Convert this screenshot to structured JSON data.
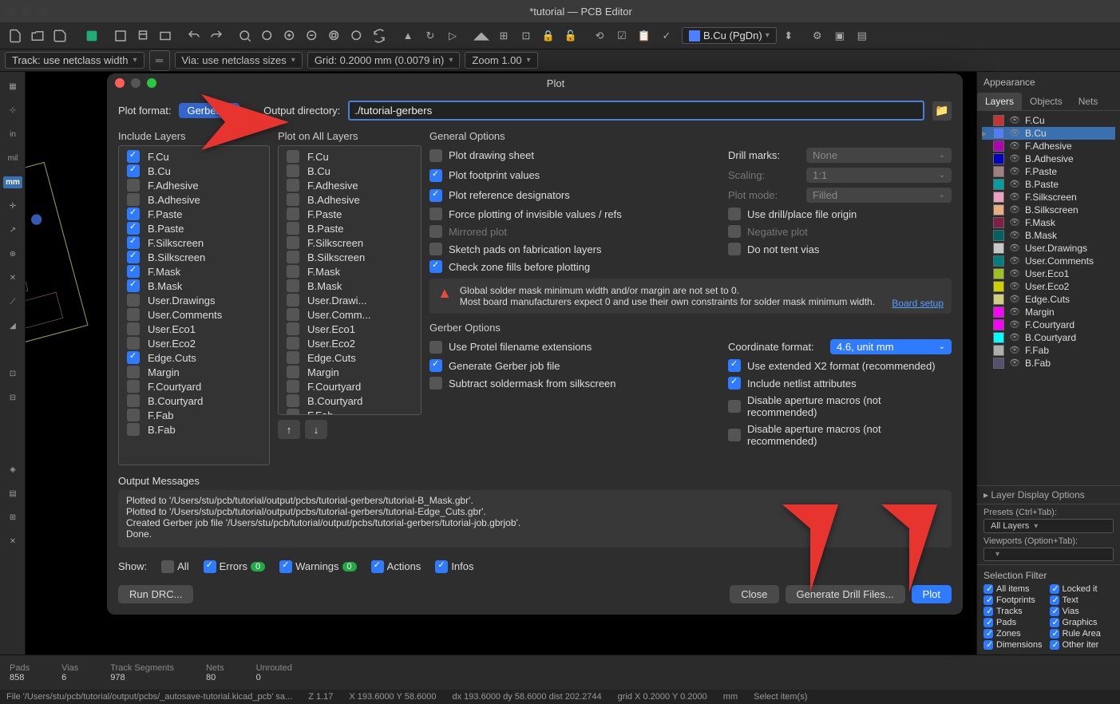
{
  "window": {
    "title": "*tutorial — PCB Editor"
  },
  "layer_selector": "B.Cu (PgDn)",
  "subtoolbar": {
    "track": "Track: use netclass width",
    "via": "Via: use netclass sizes",
    "grid": "Grid: 0.2000 mm (0.0079 in)",
    "zoom": "Zoom 1.00"
  },
  "left_toolbar": [
    "",
    "",
    "in",
    "mil",
    "mm",
    "",
    "",
    "",
    "",
    "",
    "",
    "",
    "",
    "",
    "",
    "",
    "",
    "",
    "",
    ""
  ],
  "appearance": {
    "title": "Appearance",
    "tabs": [
      "Layers",
      "Objects",
      "Nets"
    ],
    "active_tab": "Layers",
    "layers": [
      {
        "name": "F.Cu",
        "color": "#c83434",
        "sel": false
      },
      {
        "name": "B.Cu",
        "color": "#4d7fff",
        "sel": true
      },
      {
        "name": "F.Adhesive",
        "color": "#b400b4",
        "sel": false
      },
      {
        "name": "B.Adhesive",
        "color": "#0000c8",
        "sel": false
      },
      {
        "name": "F.Paste",
        "color": "#a08080",
        "sel": false
      },
      {
        "name": "B.Paste",
        "color": "#00a0a0",
        "sel": false
      },
      {
        "name": "F.Silkscreen",
        "color": "#f0a0c0",
        "sel": false
      },
      {
        "name": "B.Silkscreen",
        "color": "#e8b080",
        "sel": false
      },
      {
        "name": "F.Mask",
        "color": "#802048",
        "sel": false
      },
      {
        "name": "B.Mask",
        "color": "#006464",
        "sel": false
      },
      {
        "name": "User.Drawings",
        "color": "#c8c8c8",
        "sel": false
      },
      {
        "name": "User.Comments",
        "color": "#008080",
        "sel": false
      },
      {
        "name": "User.Eco1",
        "color": "#a0c020",
        "sel": false
      },
      {
        "name": "User.Eco2",
        "color": "#d0d000",
        "sel": false
      },
      {
        "name": "Edge.Cuts",
        "color": "#d0d080",
        "sel": false
      },
      {
        "name": "Margin",
        "color": "#ff00ff",
        "sel": false
      },
      {
        "name": "F.Courtyard",
        "color": "#ff00ff",
        "sel": false
      },
      {
        "name": "B.Courtyard",
        "color": "#00ffff",
        "sel": false
      },
      {
        "name": "F.Fab",
        "color": "#afafaf",
        "sel": false
      },
      {
        "name": "B.Fab",
        "color": "#585070",
        "sel": false
      }
    ],
    "display_opts": "Layer Display Options",
    "presets_lbl": "Presets (Ctrl+Tab):",
    "presets_val": "All Layers",
    "viewports_lbl": "Viewports (Option+Tab):"
  },
  "sel_filter": {
    "title": "Selection Filter",
    "items": [
      "All items",
      "Locked it",
      "Footprints",
      "Text",
      "Tracks",
      "Vias",
      "Pads",
      "Graphics",
      "Zones",
      "Rule Area",
      "Dimensions",
      "Other iter"
    ]
  },
  "status1": [
    {
      "lbl": "Pads",
      "val": "858"
    },
    {
      "lbl": "Vias",
      "val": "6"
    },
    {
      "lbl": "Track Segments",
      "val": "978"
    },
    {
      "lbl": "Nets",
      "val": "80"
    },
    {
      "lbl": "Unrouted",
      "val": "0"
    }
  ],
  "status2": {
    "file": "File '/Users/stu/pcb/tutorial/output/pcbs/_autosave-tutorial.kicad_pcb' sa...",
    "z": "Z 1.17",
    "xy": "X 193.6000  Y 58.6000",
    "dxy": "dx 193.6000  dy 58.6000  dist 202.2744",
    "grid": "grid X 0.2000  Y 0.2000",
    "units": "mm",
    "sel": "Select item(s)"
  },
  "dialog": {
    "title": "Plot",
    "plot_format_lbl": "Plot format:",
    "plot_format": "Gerber",
    "output_dir_lbl": "Output directory:",
    "output_dir": "./tutorial-gerbers",
    "include_layers_hdr": "Include Layers",
    "plot_all_layers_hdr": "Plot on All Layers",
    "layers": [
      {
        "name": "F.Cu",
        "inc": true,
        "all": false
      },
      {
        "name": "B.Cu",
        "inc": true,
        "all": false
      },
      {
        "name": "F.Adhesive",
        "inc": false,
        "all": false
      },
      {
        "name": "B.Adhesive",
        "inc": false,
        "all": false
      },
      {
        "name": "F.Paste",
        "inc": true,
        "all": false
      },
      {
        "name": "B.Paste",
        "inc": true,
        "all": false
      },
      {
        "name": "F.Silkscreen",
        "inc": true,
        "all": false
      },
      {
        "name": "B.Silkscreen",
        "inc": true,
        "all": false
      },
      {
        "name": "F.Mask",
        "inc": true,
        "all": false
      },
      {
        "name": "B.Mask",
        "inc": true,
        "all": false
      },
      {
        "name": "User.Drawings",
        "inc": false,
        "all": false,
        "all_name": "User.Drawi..."
      },
      {
        "name": "User.Comments",
        "inc": false,
        "all": false,
        "all_name": "User.Comm..."
      },
      {
        "name": "User.Eco1",
        "inc": false,
        "all": false
      },
      {
        "name": "User.Eco2",
        "inc": false,
        "all": false
      },
      {
        "name": "Edge.Cuts",
        "inc": true,
        "all": false
      },
      {
        "name": "Margin",
        "inc": false,
        "all": false
      },
      {
        "name": "F.Courtyard",
        "inc": false,
        "all": false
      },
      {
        "name": "B.Courtyard",
        "inc": false,
        "all": false
      },
      {
        "name": "F.Fab",
        "inc": false,
        "all": false
      },
      {
        "name": "B.Fab",
        "inc": false,
        "all": false
      }
    ],
    "general_hdr": "General Options",
    "general": [
      {
        "label": "Plot drawing sheet",
        "on": false
      },
      {
        "label": "Plot footprint values",
        "on": true
      },
      {
        "label": "Plot reference designators",
        "on": true
      },
      {
        "label": "Force plotting of invisible values / refs",
        "on": false
      },
      {
        "label": "Mirrored plot",
        "on": false,
        "disabled": true
      },
      {
        "label": "Sketch pads on fabrication layers",
        "on": false
      },
      {
        "label": "Check zone fills before plotting",
        "on": true
      }
    ],
    "general_right": [
      {
        "label": "Drill marks:",
        "type": "sel",
        "val": "None"
      },
      {
        "label": "Scaling:",
        "type": "sel",
        "val": "1:1",
        "disabled": true
      },
      {
        "label": "Plot mode:",
        "type": "sel",
        "val": "Filled",
        "disabled": true
      },
      {
        "label": "Use drill/place file origin",
        "type": "cb",
        "on": false
      },
      {
        "label": "Negative plot",
        "type": "cb",
        "on": false,
        "disabled": true
      },
      {
        "label": "Do not tent vias",
        "type": "cb",
        "on": false
      }
    ],
    "warn1": "Global solder mask minimum width and/or margin are not set to 0.",
    "warn2": "Most board manufacturers expect 0 and use their own constraints for solder mask minimum width.",
    "warn_link": "Board setup",
    "gerber_hdr": "Gerber Options",
    "gerber_left": [
      {
        "label": "Use Protel filename extensions",
        "on": false
      },
      {
        "label": "Generate Gerber job file",
        "on": true
      },
      {
        "label": "Subtract soldermask from silkscreen",
        "on": false
      }
    ],
    "coord_lbl": "Coordinate format:",
    "coord_val": "4.6, unit mm",
    "gerber_right": [
      {
        "label": "Use extended X2 format (recommended)",
        "on": true
      },
      {
        "label": "Include netlist attributes",
        "on": true
      },
      {
        "label": "Disable aperture macros (not recommended)",
        "on": false
      }
    ],
    "outmsg_hdr": "Output Messages",
    "messages": [
      "Plotted to '/Users/stu/pcb/tutorial/output/pcbs/tutorial-gerbers/tutorial-B_Mask.gbr'.",
      "Plotted to '/Users/stu/pcb/tutorial/output/pcbs/tutorial-gerbers/tutorial-Edge_Cuts.gbr'.",
      "Created Gerber job file '/Users/stu/pcb/tutorial/output/pcbs/tutorial-gerbers/tutorial-job.gbrjob'.",
      "Done."
    ],
    "show_lbl": "Show:",
    "show_all": "All",
    "show_errors": "Errors",
    "show_errors_n": "0",
    "show_warnings": "Warnings",
    "show_warnings_n": "0",
    "show_actions": "Actions",
    "show_infos": "Infos",
    "btn_rundrc": "Run DRC...",
    "btn_close": "Close",
    "btn_drill": "Generate Drill Files...",
    "btn_plot": "Plot"
  }
}
